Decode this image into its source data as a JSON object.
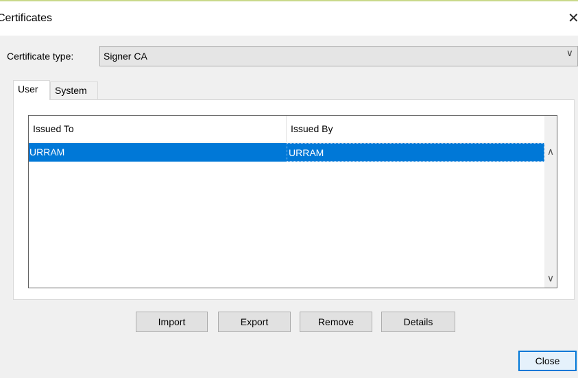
{
  "dialog": {
    "title": "Certificates",
    "close_glyph": "✕"
  },
  "certificate_type": {
    "label": "Certificate type:",
    "selected": "Signer CA",
    "chevron": "∨"
  },
  "tabs": [
    {
      "label": "User",
      "active": true
    },
    {
      "label": "System",
      "active": false
    }
  ],
  "table": {
    "columns": [
      "Issued To",
      "Issued By"
    ],
    "rows": [
      {
        "issued_to": "URRAM",
        "issued_by": "URRAM",
        "selected": true
      }
    ],
    "scroll_up_glyph": "∧",
    "scroll_down_glyph": "∨"
  },
  "buttons": {
    "import": "Import",
    "export": "Export",
    "remove": "Remove",
    "details": "Details",
    "close": "Close"
  },
  "colors": {
    "selection": "#0078d7",
    "accent_border": "#c9d98a"
  }
}
